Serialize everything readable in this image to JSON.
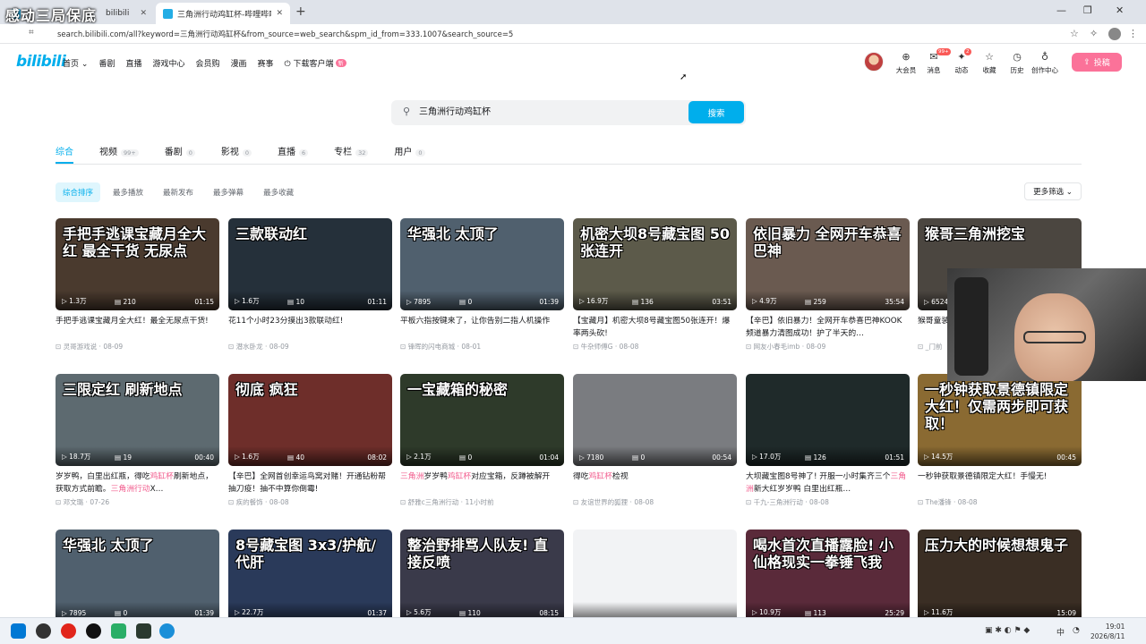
{
  "browser": {
    "overlay_text": "感动三局保底",
    "tabs": [
      {
        "label": "bilibili",
        "active": false
      },
      {
        "label": "三角洲行动鸡缸杯-哔哩哔哩_bilibili",
        "active": true
      }
    ],
    "new_tab": "+",
    "url": "search.bilibili.com/all?keyword=三角洲行动鸡缸杯&from_source=web_search&spm_id_from=333.1007&search_source=5",
    "win_minimize": "—",
    "win_maximize": "❐",
    "win_close": "✕"
  },
  "header": {
    "logo": "bilibili",
    "nav": [
      "首页",
      "番剧",
      "直播",
      "游戏中心",
      "会员购",
      "漫画",
      "赛事",
      "下载客户端"
    ],
    "home_chevron": "⌄",
    "download_badge": "新",
    "icons": [
      {
        "name": "big-member",
        "label": "大会员",
        "glyph": "⊕",
        "count": ""
      },
      {
        "name": "messages",
        "label": "消息",
        "glyph": "✉",
        "count": "99+"
      },
      {
        "name": "dynamics",
        "label": "动态",
        "glyph": "✦",
        "count": "2"
      },
      {
        "name": "favorites",
        "label": "收藏",
        "glyph": "☆",
        "count": ""
      },
      {
        "name": "history",
        "label": "历史",
        "glyph": "◷",
        "count": ""
      },
      {
        "name": "creation",
        "label": "创作中心",
        "glyph": "♁",
        "count": ""
      }
    ],
    "upload_label": "投稿"
  },
  "search": {
    "query": "三角洲行动鸡缸杯",
    "button": "搜索"
  },
  "tabs": [
    {
      "label": "综合",
      "count": "",
      "active": true
    },
    {
      "label": "视频",
      "count": "99+",
      "active": false
    },
    {
      "label": "番剧",
      "count": "0",
      "active": false
    },
    {
      "label": "影视",
      "count": "0",
      "active": false
    },
    {
      "label": "直播",
      "count": "6",
      "active": false
    },
    {
      "label": "专栏",
      "count": "32",
      "active": false
    },
    {
      "label": "用户",
      "count": "0",
      "active": false
    }
  ],
  "sort": {
    "options": [
      "综合排序",
      "最多播放",
      "最新发布",
      "最多弹幕",
      "最多收藏"
    ],
    "active": 0,
    "more_filter": "更多筛选 ⌄"
  },
  "videos": [
    {
      "thumb_text": "手把手逃课宝藏月全大红 最全干货 无尿点",
      "plays": "1.3万",
      "danmaku": "210",
      "duration": "01:15",
      "title_parts": [
        [
          "手把手逃课宝藏月全大红！最全无尿点干货!",
          false
        ]
      ],
      "author": "灵哥游戏说",
      "date": "08-09",
      "color": "#4a3a2e"
    },
    {
      "thumb_text": "三款联动红",
      "plays": "1.6万",
      "danmaku": "10",
      "duration": "01:11",
      "title_parts": [
        [
          "花11个小时23分摸出3款联动红!",
          false
        ]
      ],
      "author": "潜水卧龙",
      "date": "08-09",
      "color": "#25303a"
    },
    {
      "thumb_text": "华强北 太顶了",
      "plays": "7895",
      "danmaku": "0",
      "duration": "01:39",
      "title_parts": [
        [
          "平板六指按键来了，让你告别二指人机操作",
          false
        ]
      ],
      "author": "锋晖的闪电商城",
      "date": "08-01",
      "color": "#50606e"
    },
    {
      "thumb_text": "机密大坝8号藏宝图 50张连开",
      "plays": "16.9万",
      "danmaku": "136",
      "duration": "03:51",
      "title_parts": [
        [
          "【宝藏月】机密大坝8号藏宝图50张连开！爆率两头砍!",
          false
        ]
      ],
      "author": "牛杂师傅G",
      "date": "08-08",
      "color": "#5c5a4a"
    },
    {
      "thumb_text": "依旧暴力 全网开车恭喜巴神",
      "plays": "4.9万",
      "danmaku": "259",
      "duration": "35:54",
      "title_parts": [
        [
          "【辛巴】依旧暴力！全网开车恭喜巴神KOOK频道暴力清图成功！护了半天的…",
          false
        ]
      ],
      "author": "网友小春毛imb",
      "date": "08-09",
      "color": "#6a5a50"
    },
    {
      "thumb_text": "猴哥三角洲挖宝",
      "plays": "6524",
      "danmaku": "",
      "duration": "",
      "title_parts": [
        [
          "猴哥童装…",
          false
        ],
        [
          "鸡缸杯",
          true
        ]
      ],
      "author": "_门前",
      "date": "",
      "color": "#4b4640"
    },
    {
      "thumb_text": "三限定红 刷新地点",
      "plays": "18.7万",
      "danmaku": "19",
      "duration": "00:40",
      "title_parts": [
        [
          "岁岁鸭，白里出红瓶，得吃",
          false
        ],
        [
          "鸡缸杯",
          true
        ],
        [
          "刷新地点，获取方式前瞻。",
          false
        ],
        [
          "三角洲行动",
          true
        ],
        [
          "X…",
          false
        ]
      ],
      "author": "邓文璐",
      "date": "07-26",
      "color": "#5d6a70"
    },
    {
      "thumb_text": "彻底 疯狂",
      "plays": "1.6万",
      "danmaku": "40",
      "duration": "08:02",
      "title_parts": [
        [
          "【辛巴】全网首创幸运鸟窝对赌！开通钻粉帮抽刀疫！抽不中算你倒霉!",
          false
        ]
      ],
      "author": "疾的餐饰",
      "date": "08-08",
      "color": "#6e2e2a"
    },
    {
      "thumb_text": "一宝藏箱的秘密",
      "plays": "2.1万",
      "danmaku": "0",
      "duration": "01:04",
      "title_parts": [
        [
          "三角洲",
          true
        ],
        [
          "岁岁鸭",
          false
        ],
        [
          "鸡缸杯",
          true
        ],
        [
          "对应宝箱，反蹲被解开",
          false
        ]
      ],
      "author": "舒雅c三角洲行动",
      "date": "11小时前",
      "color": "#2e3a2a"
    },
    {
      "thumb_text": "",
      "plays": "7180",
      "danmaku": "0",
      "duration": "00:54",
      "title_parts": [
        [
          "得吃",
          false
        ],
        [
          "鸡缸杯",
          true
        ],
        [
          "检视",
          false
        ]
      ],
      "author": "友谊世界的狐狸",
      "date": "08-08",
      "color": "#7a7c80"
    },
    {
      "thumb_text": "",
      "plays": "17.0万",
      "danmaku": "126",
      "duration": "01:51",
      "title_parts": [
        [
          "大坝藏宝图8号神了! 开服一小时集齐三个",
          false
        ],
        [
          "三角洲",
          true
        ],
        [
          "新大红岁岁鸭 白里出红瓶…",
          false
        ]
      ],
      "author": "千九-三角洲行动",
      "date": "08-08",
      "color": "#1f2a2a"
    },
    {
      "thumb_text": "一秒钟获取景德镇限定大红！仅需两步即可获取！",
      "plays": "14.5万",
      "danmaku": "",
      "duration": "00:45",
      "title_parts": [
        [
          "一秒钟获取景德镇限定大红！手慢无!",
          false
        ]
      ],
      "author": "The潘锋",
      "date": "08-08",
      "color": "#8a6a32"
    },
    {
      "thumb_text": "华强北 太顶了",
      "plays": "7895",
      "danmaku": "0",
      "duration": "01:39",
      "title_parts": [
        [
          "",
          false
        ]
      ],
      "author": "",
      "date": "",
      "color": "#50606e"
    },
    {
      "thumb_text": "8号藏宝图 3x3/护航/代肝",
      "plays": "22.7万",
      "danmaku": "",
      "duration": "01:37",
      "title_parts": [
        [
          "",
          false
        ]
      ],
      "author": "",
      "date": "",
      "color": "#2a3a5a"
    },
    {
      "thumb_text": "整治野排骂人队友! 直接反喷",
      "plays": "5.6万",
      "danmaku": "110",
      "duration": "08:15",
      "title_parts": [
        [
          "",
          false
        ]
      ],
      "author": "",
      "date": "",
      "color": "#3a3a4a"
    },
    {
      "thumb_text": "",
      "plays": "",
      "danmaku": "",
      "duration": "",
      "title_parts": [
        [
          "",
          false
        ]
      ],
      "author": "",
      "date": "",
      "color": "#f2f3f5"
    },
    {
      "thumb_text": "喝水首次直播露脸! 小仙格现实一拳锤飞我",
      "plays": "10.9万",
      "danmaku": "113",
      "duration": "25:29",
      "title_parts": [
        [
          "",
          false
        ]
      ],
      "author": "",
      "date": "",
      "color": "#5a2a3a"
    },
    {
      "thumb_text": "压力大的时候想想鬼子",
      "plays": "11.6万",
      "danmaku": "",
      "duration": "15:09",
      "title_parts": [
        [
          "",
          false
        ]
      ],
      "author": "",
      "date": "",
      "color": "#3a2e24"
    }
  ],
  "taskbar": {
    "tray": "中",
    "time": "19:01",
    "date": "2026/8/11"
  }
}
